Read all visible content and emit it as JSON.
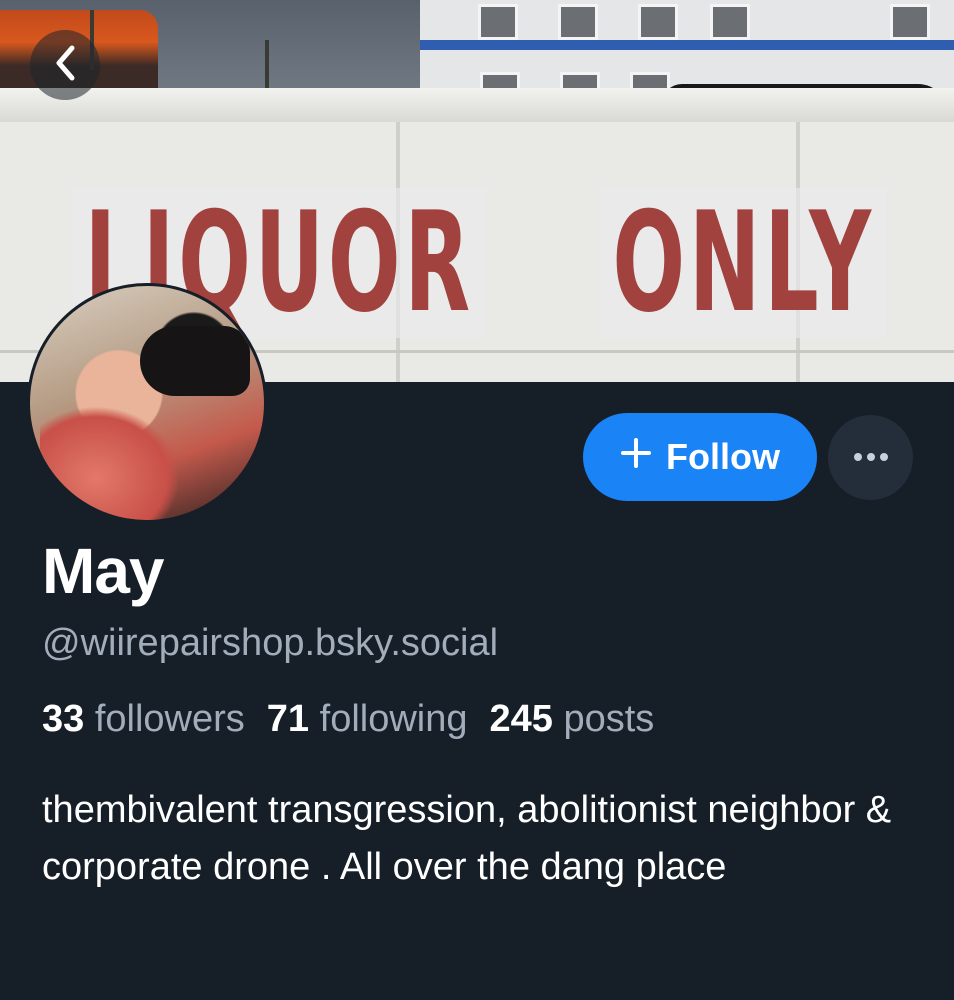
{
  "banner": {
    "stencil_left": "LIQUOR",
    "stencil_right": "ONLY"
  },
  "icons": {
    "back": "chevron-left-icon",
    "follow_plus": "plus-icon",
    "more": "ellipsis-icon"
  },
  "actions": {
    "follow_label": "Follow"
  },
  "profile": {
    "display_name": "May",
    "handle": "@wiirepairshop.bsky.social",
    "bio": "thembivalent transgression, abolitionist neighbor & corporate drone . All over the dang place"
  },
  "stats": {
    "followers_count": "33",
    "followers_label": "followers",
    "following_count": "71",
    "following_label": "following",
    "posts_count": "245",
    "posts_label": "posts"
  },
  "colors": {
    "background": "#161e27",
    "accent": "#1a83f5",
    "muted_text": "#a2adbb",
    "secondary_button": "#242e3b"
  }
}
